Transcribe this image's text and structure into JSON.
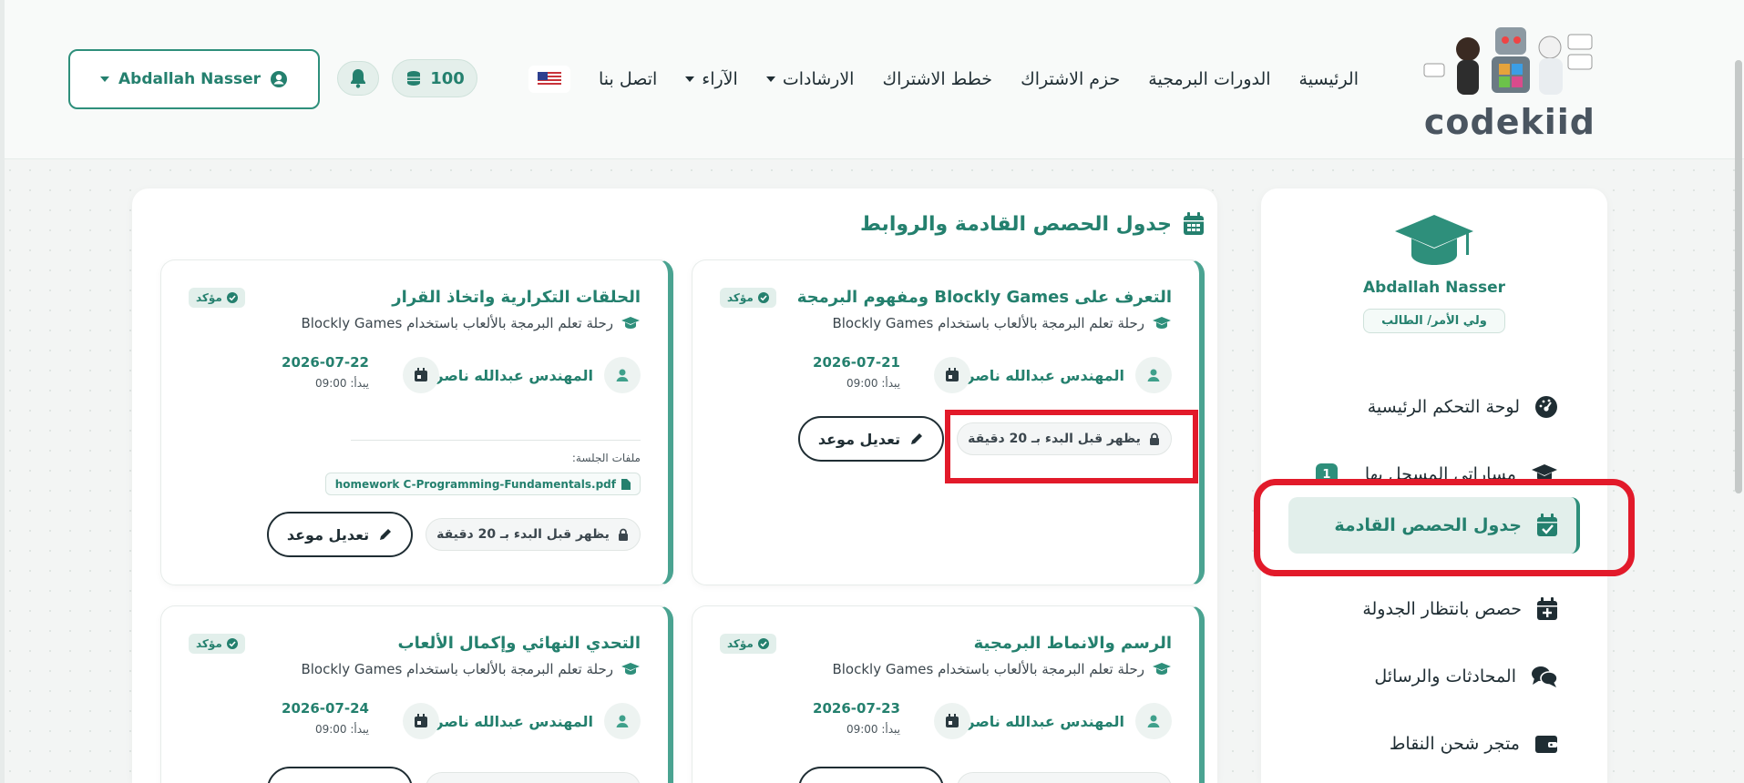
{
  "header": {
    "logo_text": "codekiid",
    "nav": [
      {
        "label": "الرئيسية",
        "dropdown": false
      },
      {
        "label": "الدورات البرمجية",
        "dropdown": false
      },
      {
        "label": "حزم الاشتراك",
        "dropdown": false
      },
      {
        "label": "خطط الاشتراك",
        "dropdown": false
      },
      {
        "label": "الارشادات",
        "dropdown": true
      },
      {
        "label": "الآراء",
        "dropdown": true
      },
      {
        "label": "اتصل بنا",
        "dropdown": false
      }
    ],
    "language_flag": "us-flag",
    "points": "100",
    "user_name": "Abdallah Nasser"
  },
  "sidebar": {
    "name": "Abdallah Nasser",
    "role": "ولي الأمر/ الطالب",
    "items": [
      {
        "label": "لوحة التحكم الرئيسية",
        "icon": "dashboard-icon"
      },
      {
        "label": "مساراتي المسجل بها",
        "icon": "graduation-cap-icon",
        "badge": "1"
      },
      {
        "label": "جدول الحصص القادمة",
        "icon": "calendar-check-icon",
        "active": true
      },
      {
        "label": "حصص بانتظار الجدولة",
        "icon": "calendar-plus-icon"
      },
      {
        "label": "المحادثات والرسائل",
        "icon": "chat-icon"
      },
      {
        "label": "متجر شحن النقاط",
        "icon": "wallet-icon"
      }
    ]
  },
  "main": {
    "title": "جدول الحصص القادمة والروابط",
    "cards": [
      {
        "title": "التعرف على Blockly Games ومفهوم البرمجة",
        "status": "مؤكد",
        "course": "رحلة تعلم البرمجة بالألعاب باستخدام Blockly Games",
        "teacher": "المهندس عبدالله ناصر",
        "date": "2026-07-21",
        "start": "يبدأ: 09:00",
        "lock_text": "يظهر قبل البدء بـ 20 دقيقة",
        "edit_label": "تعديل موعد"
      },
      {
        "title": "الحلقات التكرارية واتخاذ القرار",
        "status": "مؤكد",
        "course": "رحلة تعلم البرمجة بالألعاب باستخدام Blockly Games",
        "teacher": "المهندس عبدالله ناصر",
        "date": "2026-07-22",
        "start": "يبدأ: 09:00",
        "files_label": "ملفات الجلسة:",
        "file_name": "homework C-Programming-Fundamentals.pdf",
        "lock_text": "يظهر قبل البدء بـ 20 دقيقة",
        "edit_label": "تعديل موعد"
      },
      {
        "title": "الرسم والانماط البرمجية",
        "status": "مؤكد",
        "course": "رحلة تعلم البرمجة بالألعاب باستخدام Blockly Games",
        "teacher": "المهندس عبدالله ناصر",
        "date": "2026-07-23",
        "start": "يبدأ: 09:00"
      },
      {
        "title": "التحدي النهائي وإكمال الألعاب",
        "status": "مؤكد",
        "course": "رحلة تعلم البرمجة بالألعاب باستخدام Blockly Games",
        "teacher": "المهندس عبدالله ناصر",
        "date": "2026-07-24",
        "start": "يبدأ: 09:00"
      }
    ]
  },
  "colors": {
    "accent": "#24806e",
    "highlight": "#e21a2a"
  }
}
